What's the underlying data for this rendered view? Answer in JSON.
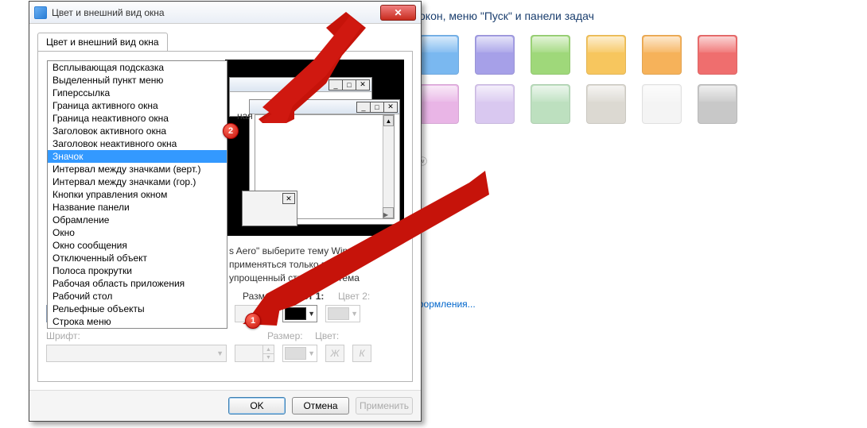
{
  "bg": {
    "partial_title": "окон, меню \"Пуск\" и панели задач",
    "swatches_row1": [
      "#7ab8f0",
      "#a6a0e8",
      "#9fd87a",
      "#f7c65e",
      "#f6b25a",
      "#ef6e6e"
    ],
    "swatches_row2": [
      "#e9b5e6",
      "#d9c8f0",
      "#bde0bf",
      "#dcd9d2",
      "#f4f4f4",
      "#c8c8c8"
    ],
    "link": "оформления...",
    "partial_char": "й"
  },
  "dialog": {
    "title": "Цвет и внешний вид окна",
    "tab": "Цвет и внешний вид окна",
    "preview_caption_fragment": "ная",
    "info_line1": "s Aero\" выберите тему Windows.",
    "info_line2": "применяться только в том",
    "info_line3": "упрощенный стиль\" или тема",
    "element_label_implicit": "",
    "size_label": "Размер:",
    "color1_label": "Цвет 1:",
    "color2_label": "Цвет 2:",
    "font_label": "Шрифт:",
    "font_size_label": "Размер:",
    "font_color_label": "Цвет:",
    "bold_label": "Ж",
    "italic_label": "К",
    "element_value": "Рабочий стол",
    "ok": "OK",
    "cancel": "Отмена",
    "apply": "Применить"
  },
  "list": {
    "items": [
      "Всплывающая подсказка",
      "Выделенный пункт меню",
      "Гиперссылка",
      "Граница активного окна",
      "Граница неактивного окна",
      "Заголовок активного окна",
      "Заголовок неактивного окна",
      "Значок",
      "Интервал между значками (верт.)",
      "Интервал между значками (гор.)",
      "Кнопки управления окном",
      "Название панели",
      "Обрамление",
      "Окно",
      "Окно сообщения",
      "Отключенный объект",
      "Полоса прокрутки",
      "Рабочая область приложения",
      "Рабочий стол",
      "Рельефные объекты",
      "Строка меню"
    ],
    "selected_index": 7
  },
  "markers": {
    "m1": "1",
    "m2": "2"
  }
}
